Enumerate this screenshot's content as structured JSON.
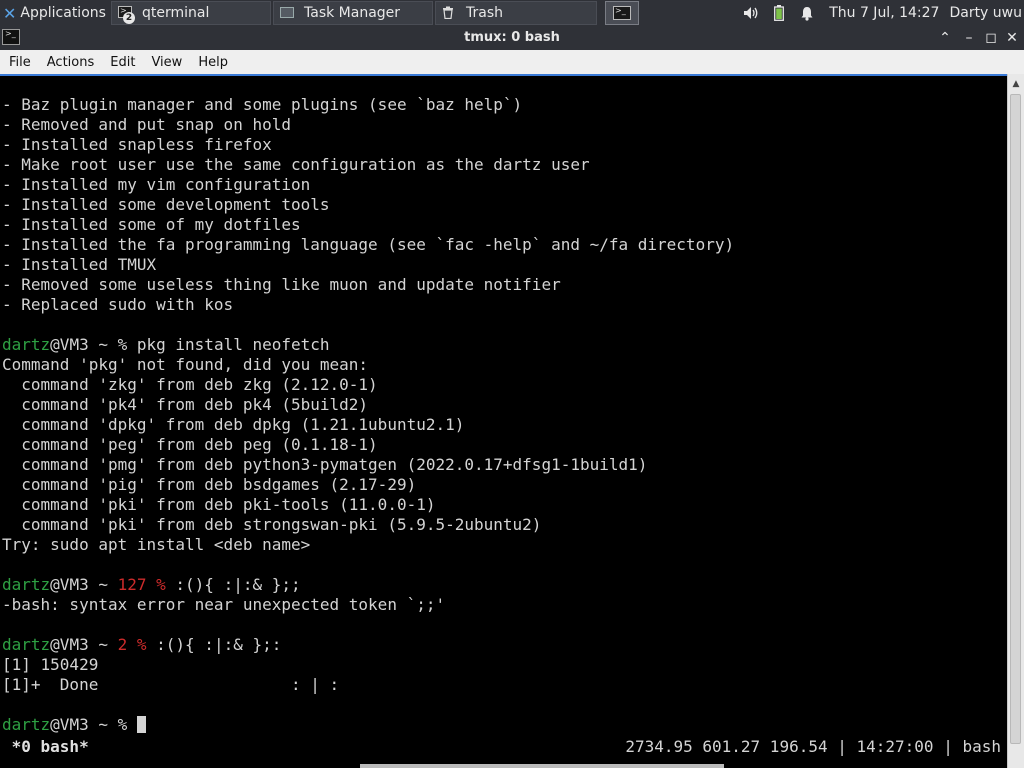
{
  "panel": {
    "applications_label": "Applications",
    "tasks": [
      {
        "label": "qterminal",
        "badge": "2",
        "icon": "terminal-icon"
      },
      {
        "label": "Task Manager",
        "icon": "task-manager-icon"
      },
      {
        "label": "Trash",
        "icon": "trash-icon"
      }
    ],
    "active_task_icon": "terminal-icon",
    "tray": {
      "volume_icon": "volume-icon",
      "battery_icon": "battery-icon",
      "notification_icon": "bell-icon"
    },
    "clock": "Thu  7 Jul, 14:27",
    "user": "Darty uwu"
  },
  "window": {
    "title": "tmux: 0 bash"
  },
  "menu": [
    "File",
    "Actions",
    "Edit",
    "View",
    "Help"
  ],
  "terminal": {
    "lines": [
      "- Baz plugin manager and some plugins (see `baz help`)",
      "- Removed and put snap on hold",
      "- Installed snapless firefox",
      "- Make root user use the same configuration as the dartz user",
      "- Installed my vim configuration",
      "- Installed some development tools",
      "- Installed some of my dotfiles",
      "- Installed the fa programming language (see `fac -help` and ~/fa directory)",
      "- Installed TMUX",
      "- Removed some useless thing like muon and update notifier",
      "- Replaced sudo with kos",
      "",
      {
        "prompt_user": "dartz",
        "prompt_host": "@VM3 ~ ",
        "exit_code": "",
        "prompt_sym": "% ",
        "cmd": "pkg install neofetch"
      },
      "Command 'pkg' not found, did you mean:",
      "  command 'zkg' from deb zkg (2.12.0-1)",
      "  command 'pk4' from deb pk4 (5build2)",
      "  command 'dpkg' from deb dpkg (1.21.1ubuntu2.1)",
      "  command 'peg' from deb peg (0.1.18-1)",
      "  command 'pmg' from deb python3-pymatgen (2022.0.17+dfsg1-1build1)",
      "  command 'pig' from deb bsdgames (2.17-29)",
      "  command 'pki' from deb pki-tools (11.0.0-1)",
      "  command 'pki' from deb strongswan-pki (5.9.5-2ubuntu2)",
      "Try: sudo apt install <deb name>",
      "",
      {
        "prompt_user": "dartz",
        "prompt_host": "@VM3 ~ ",
        "exit_code": "127 % ",
        "prompt_sym": "",
        "cmd": ":(){ :|:& };;"
      },
      "-bash: syntax error near unexpected token `;;'",
      "",
      {
        "prompt_user": "dartz",
        "prompt_host": "@VM3 ~ ",
        "exit_code": "2 % ",
        "prompt_sym": "",
        "cmd": ":(){ :|:& };:"
      },
      "[1] 150429",
      "[1]+  Done                    : | :",
      "",
      {
        "prompt_user": "dartz",
        "prompt_host": "@VM3 ~ ",
        "exit_code": "",
        "prompt_sym": "% ",
        "cmd": "",
        "cursor": true
      }
    ],
    "status_left": " *0 bash*",
    "status_right": "2734.95 601.27 196.54 | 14:27:00 | bash"
  },
  "colors": {
    "prompt_user": "#2ea043",
    "exit_code": "#cd2b2b",
    "accent": "#3a7ad6"
  }
}
